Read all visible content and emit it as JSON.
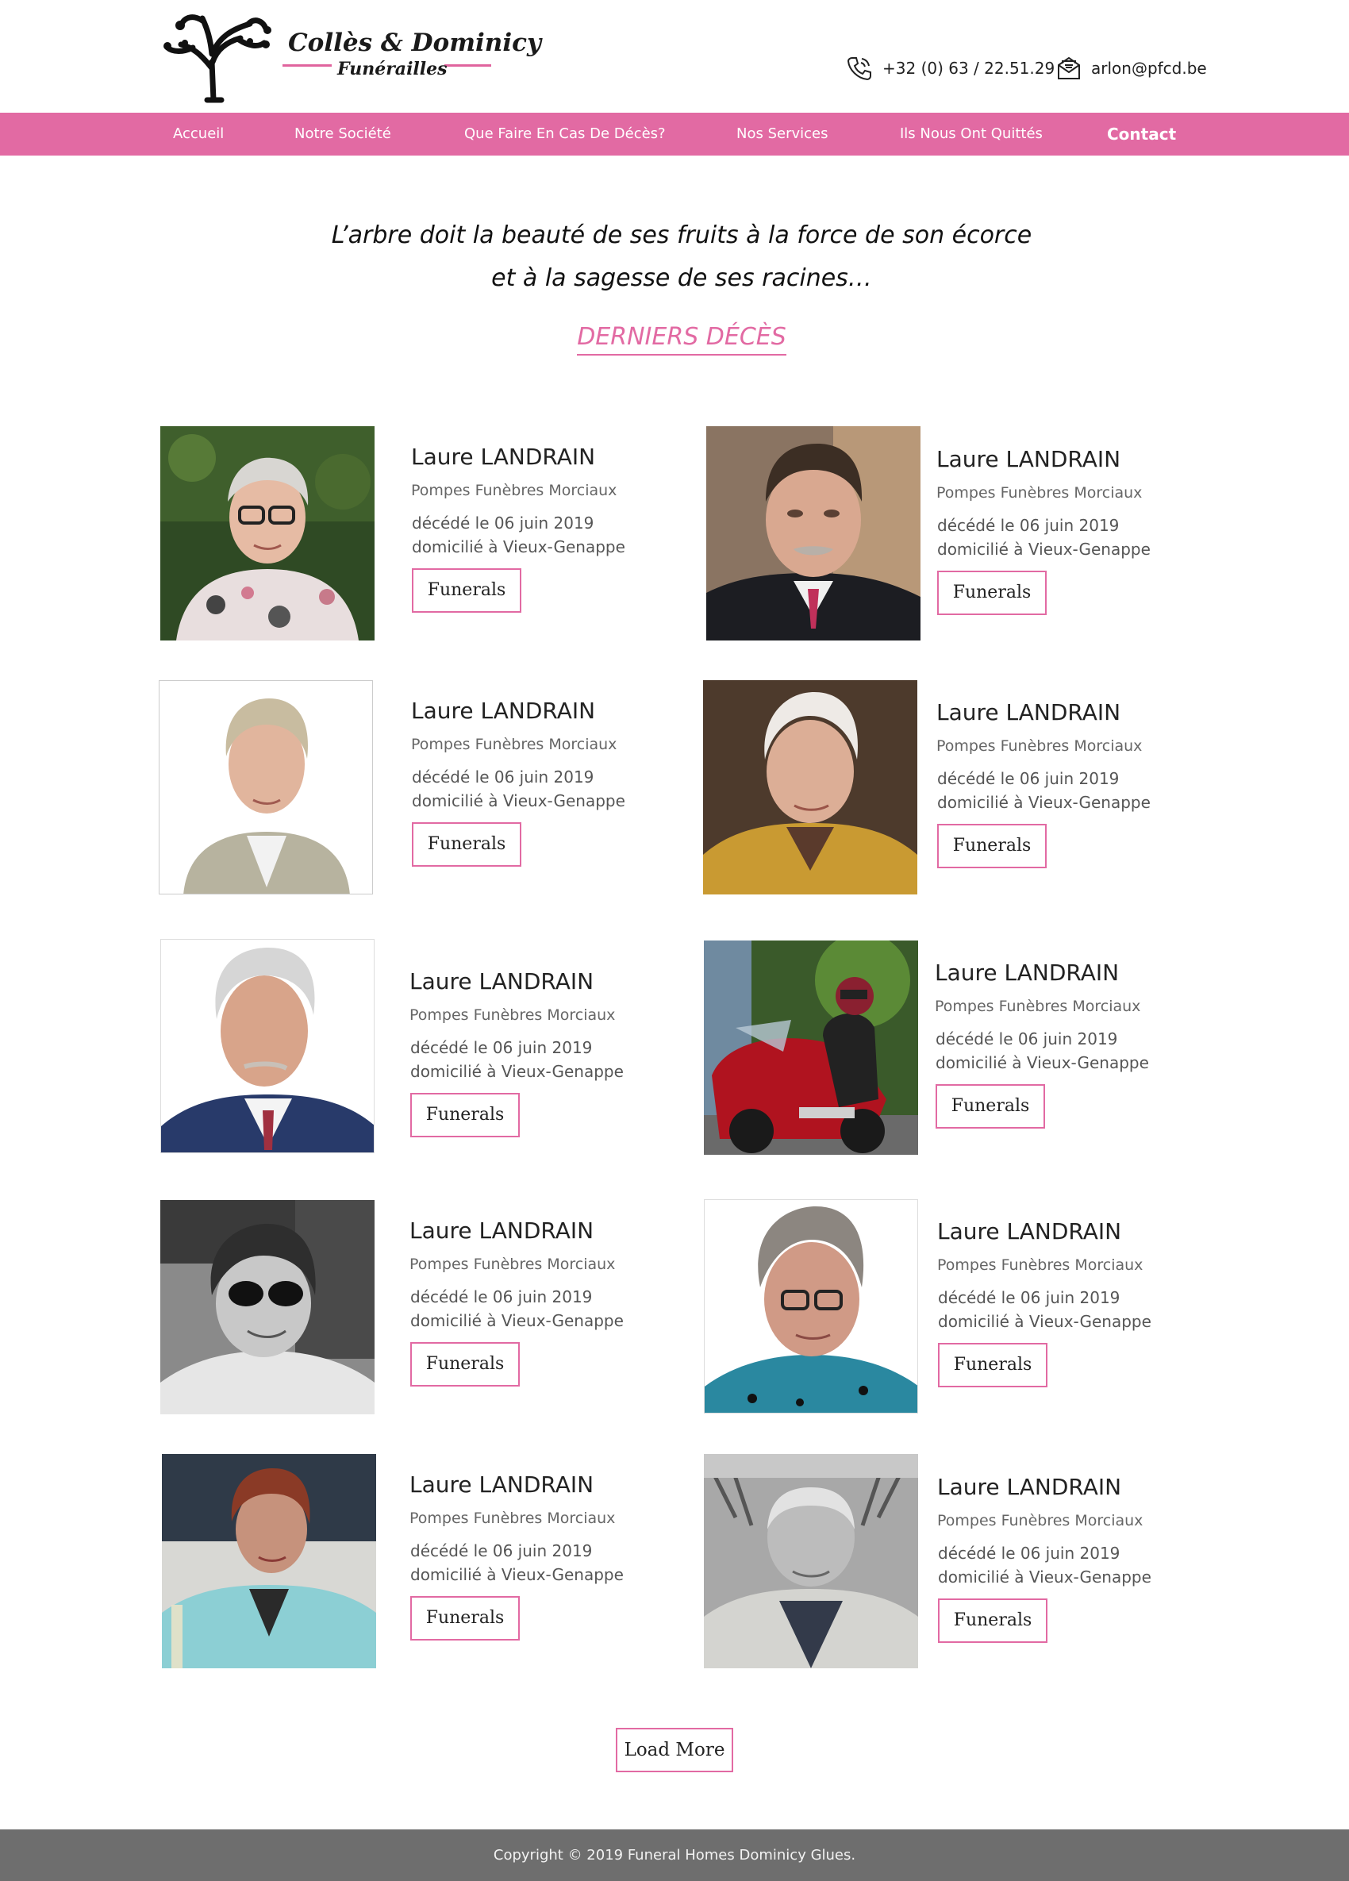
{
  "header": {
    "logo_name": "Collès & Dominicy",
    "logo_sub": "Funérailles",
    "phone": "+32 (0) 63 / 22.51.29",
    "email": "arlon@pfcd.be",
    "accent_color": "#e26aa3"
  },
  "nav": {
    "items": [
      {
        "label": "Accueil"
      },
      {
        "label": "Notre Société"
      },
      {
        "label": "Que Faire En Cas De Décès?"
      },
      {
        "label": "Nos Services"
      },
      {
        "label": "Ils Nous Ont Quittés"
      },
      {
        "label": "Contact"
      }
    ]
  },
  "hero": {
    "quote_line1": "L’arbre doit la beauté de ses fruits à la force de son écorce",
    "quote_line2": "et à la sagesse de ses racines…",
    "section_title": "DERNIERS DÉCÈS"
  },
  "obituaries": [
    {
      "name": "Laure LANDRAIN",
      "company": "Pompes Funèbres Morciaux",
      "date": "décédé le 06 juin 2019",
      "address": "domicilié à Vieux-Genappe",
      "button": "Funerals",
      "photo": "portrait-woman-glasses-garden"
    },
    {
      "name": "Laure LANDRAIN",
      "company": "Pompes Funèbres Morciaux",
      "date": "décédé le 06 juin 2019",
      "address": "domicilié à Vieux-Genappe",
      "button": "Funerals",
      "photo": "portrait-elderly-man-suit"
    },
    {
      "name": "Laure LANDRAIN",
      "company": "Pompes Funèbres Morciaux",
      "date": "décédé le 06 juin 2019",
      "address": "domicilié à Vieux-Genappe",
      "button": "Funerals",
      "photo": "portrait-woman-white-background"
    },
    {
      "name": "Laure LANDRAIN",
      "company": "Pompes Funèbres Morciaux",
      "date": "décédé le 06 juin 2019",
      "address": "domicilié à Vieux-Genappe",
      "button": "Funerals",
      "photo": "portrait-elderly-woman-yellow-cardigan"
    },
    {
      "name": "Laure LANDRAIN",
      "company": "Pompes Funèbres Morciaux",
      "date": "décédé le 06 juin 2019",
      "address": "domicilié à Vieux-Genappe",
      "button": "Funerals",
      "photo": "portrait-man-white-hair-blazer"
    },
    {
      "name": "Laure LANDRAIN",
      "company": "Pompes Funèbres Morciaux",
      "date": "décédé le 06 juin 2019",
      "address": "domicilié à Vieux-Genappe",
      "button": "Funerals",
      "photo": "photo-motorcyclist"
    },
    {
      "name": "Laure LANDRAIN",
      "company": "Pompes Funèbres Morciaux",
      "date": "décédé le 06 juin 2019",
      "address": "domicilié à Vieux-Genappe",
      "button": "Funerals",
      "photo": "portrait-woman-sunglasses-bw"
    },
    {
      "name": "Laure LANDRAIN",
      "company": "Pompes Funèbres Morciaux",
      "date": "décédé le 06 juin 2019",
      "address": "domicilié à Vieux-Genappe",
      "button": "Funerals",
      "photo": "portrait-elderly-woman-glasses"
    },
    {
      "name": "Laure LANDRAIN",
      "company": "Pompes Funèbres Morciaux",
      "date": "décédé le 06 juin 2019",
      "address": "domicilié à Vieux-Genappe",
      "button": "Funerals",
      "photo": "portrait-woman-blue-jacket"
    },
    {
      "name": "Laure LANDRAIN",
      "company": "Pompes Funèbres Morciaux",
      "date": "décédé le 06 juin 2019",
      "address": "domicilié à Vieux-Genappe",
      "button": "Funerals",
      "photo": "portrait-elderly-man-bw"
    }
  ],
  "load_more": "Load More",
  "footer": {
    "copyright": "Copyright © 2019 Funeral Homes Dominicy Glues."
  }
}
